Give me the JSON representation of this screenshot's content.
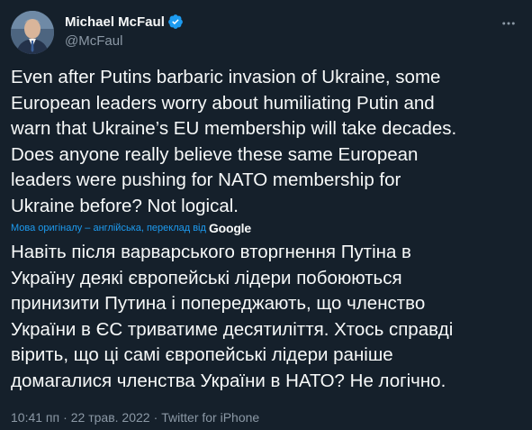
{
  "author": {
    "display_name": "Michael McFaul",
    "handle": "@McFaul",
    "verified_icon": "verified-badge-icon",
    "accent": "#1d9bf0"
  },
  "tweet": {
    "text": "Even after Putins barbaric invasion of Ukraine, some\nEuropean leaders worry about humiliating Putin and\nwarn that Ukraine’s EU membership will take decades.\nDoes anyone really believe these same European\nleaders were pushing for NATO membership for\nUkraine before? Not logical.",
    "translation_note": "Мова оригіналу – англійська, переклад від",
    "translation_provider": "Google",
    "translated_text": "Навіть після варварського вторгнення Путіна в\nУкраїну деякі європейські лідери побоюються\nпринизити Путина і попереджають, що членство\nУкраїни в ЄС триватиме десятиліття. Хтось справді\nвірить, що ці самі європейські лідери раніше\nдомагалися членства України в НАТО? Не логічно.",
    "time": "10:41 пп",
    "separator": "·",
    "date": "22 трав. 2022",
    "source": "Twitter for iPhone"
  },
  "icons": {
    "more": "more-options-icon"
  },
  "colors": {
    "background": "#15202b",
    "text": "#f7f9f9",
    "secondary": "#8b98a5",
    "link": "#1d9bf0"
  }
}
